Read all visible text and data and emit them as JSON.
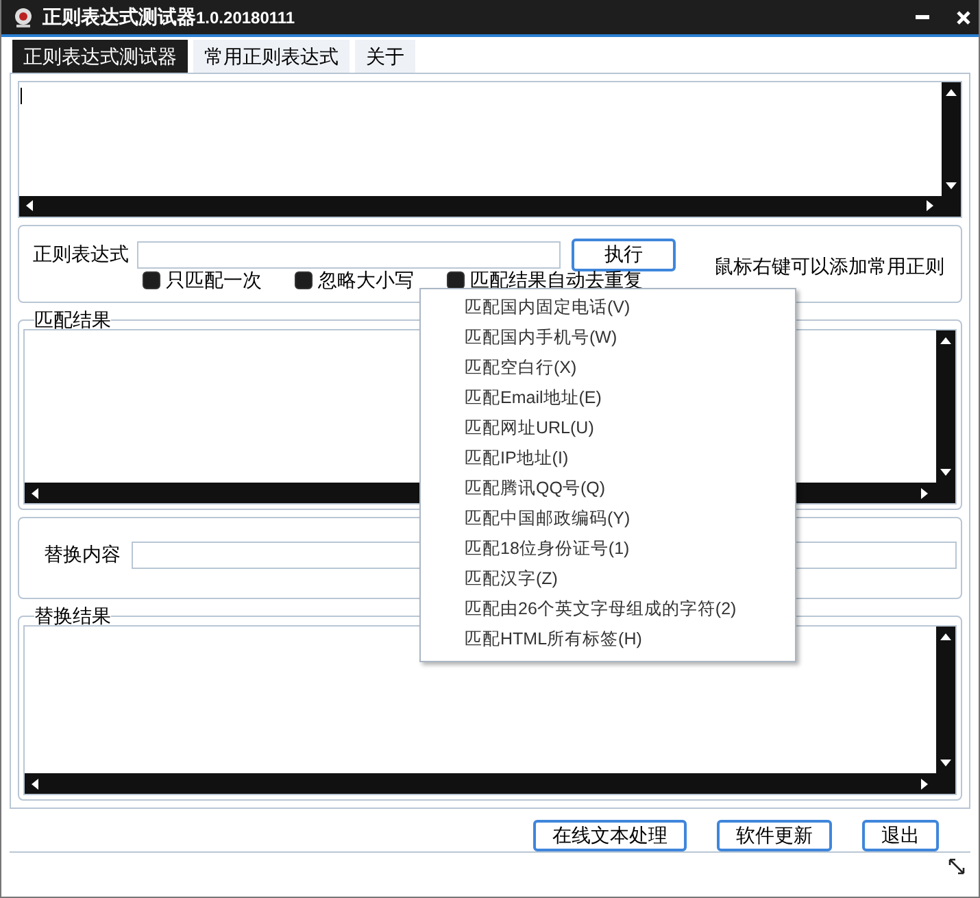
{
  "window": {
    "title": "正则表达式测试器",
    "version": "1.0.20180111"
  },
  "tabs": [
    {
      "label": "正则表达式测试器",
      "selected": true
    },
    {
      "label": "常用正则表达式",
      "selected": false
    },
    {
      "label": "关于",
      "selected": false
    }
  ],
  "input_area": {
    "has_cursor": true
  },
  "regex": {
    "label": "正则表达式",
    "run_button": "执行",
    "hint": "鼠标右键可以添加常用正则"
  },
  "options": [
    {
      "label": "只匹配一次",
      "checked": true
    },
    {
      "label": "忽略大小写",
      "checked": true
    },
    {
      "label": "匹配结果自动去重复",
      "checked": true
    }
  ],
  "match_result": {
    "title": "匹配结果"
  },
  "replace": {
    "label": "替换内容"
  },
  "replace_result": {
    "title": "替换结果"
  },
  "buttons": [
    "在线文本处理",
    "软件更新",
    "退出"
  ],
  "context_menu": [
    {
      "label": "匹配国内固定电话(V)"
    },
    {
      "label": "匹配国内手机号(W)"
    },
    {
      "label": "匹配空白行(X)"
    },
    {
      "label": "匹配Email地址(E)"
    },
    {
      "label": "匹配网址URL(U)"
    },
    {
      "label": "匹配IP地址(I)"
    },
    {
      "label": "匹配腾讯QQ号(Q)"
    },
    {
      "label": "匹配中国邮政编码(Y)"
    },
    {
      "label": "匹配18位身份证号(1)"
    },
    {
      "label": "匹配汉字(Z)"
    },
    {
      "label": "匹配由26个英文字母组成的字符(2)"
    },
    {
      "label": "匹配HTML所有标签(H)"
    }
  ]
}
